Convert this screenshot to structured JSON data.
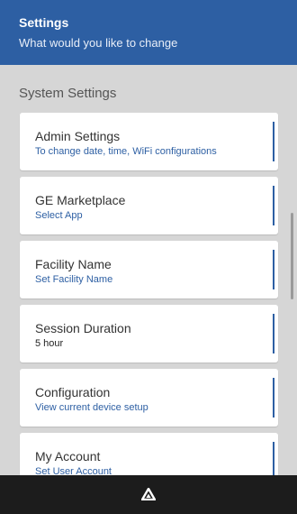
{
  "header": {
    "title": "Settings",
    "subtitle": "What would you like to change"
  },
  "section": {
    "heading": "System Settings"
  },
  "items": [
    {
      "title": "Admin Settings",
      "subtitle": "To change date, time, WiFi configurations"
    },
    {
      "title": "GE Marketplace",
      "subtitle": "Select App"
    },
    {
      "title": "Facility Name",
      "subtitle": "Set Facility Name"
    },
    {
      "title": "Session Duration",
      "subtitle": "5 hour"
    },
    {
      "title": "Configuration",
      "subtitle": "View current device setup"
    },
    {
      "title": "My Account",
      "subtitle": "Set User Account"
    }
  ],
  "bottom_bar": {
    "icon": "triangle-home-icon"
  },
  "colors": {
    "header_bg": "#2d5fa3",
    "accent": "#2d5fa3",
    "page_bg": "#d6d6d6",
    "bottom_bar_bg": "#1c1c1c"
  }
}
